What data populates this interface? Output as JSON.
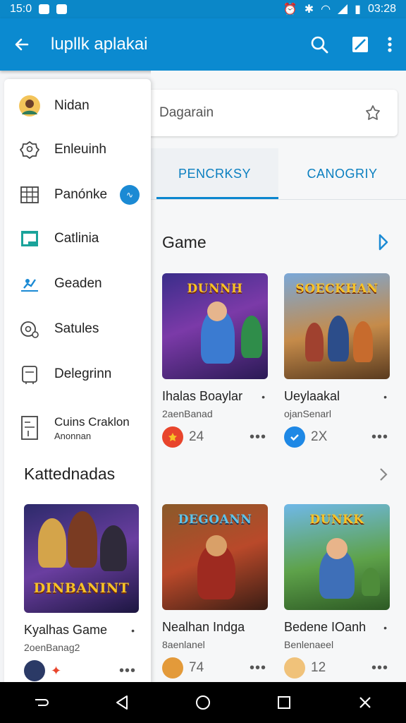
{
  "status_bar": {
    "time": "15:0",
    "clock": "03:28"
  },
  "app_bar": {
    "title": "lupllk aplakai"
  },
  "search": {
    "placeholder": "Dagarain"
  },
  "tabs": [
    {
      "label": "PENCRKSY"
    },
    {
      "label": "CANOGRIY"
    }
  ],
  "drawer": {
    "items": [
      {
        "label": "Nidan"
      },
      {
        "label": "Enleuinh"
      },
      {
        "label": "Panónke"
      },
      {
        "label": "Catlinia"
      },
      {
        "label": "Geaden"
      },
      {
        "label": "Satules"
      },
      {
        "label": "Delegrinn"
      },
      {
        "label": "Cuins Craklon",
        "sublabel": "Anonnan"
      }
    ],
    "section_title": "Kattednadas"
  },
  "sections": [
    {
      "title": "Game",
      "cards": [
        {
          "logo": "DUNNH",
          "title": "Ihalas Boaylar",
          "subtitle": "2aenBanad",
          "count": "24",
          "badge_color": "#e8452c"
        },
        {
          "logo": "SOECKHAN",
          "title": "Ueylaakal",
          "subtitle": "ojanSenarl",
          "count": "2X",
          "badge_color": "#1e88e5"
        }
      ]
    },
    {
      "cards": [
        {
          "logo": "DINBANINT",
          "title": "Kyalhas Game",
          "subtitle": "2oenBanag2",
          "count": "",
          "badge_color": "#2b3a66"
        },
        {
          "logo": "DEGOANN",
          "title": "Nealhan Indga",
          "subtitle": "8aenlanel",
          "count": "74",
          "badge_color": "#e39a3a"
        },
        {
          "logo": "DUNKK",
          "title": "Bedene IOanh",
          "subtitle": "Benlenaeel",
          "count": "12",
          "badge_color": "#f0c27a"
        }
      ]
    }
  ],
  "colors": {
    "primary": "#0b8ad0",
    "accent": "#0a86cf"
  }
}
